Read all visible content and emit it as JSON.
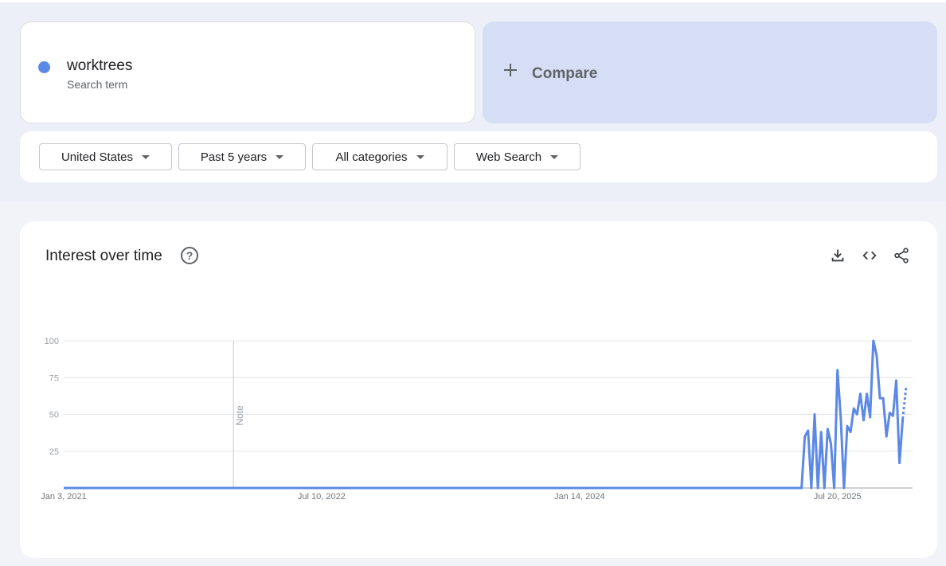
{
  "search_term": {
    "name": "worktrees",
    "subtitle": "Search term",
    "color": "#5c88e6"
  },
  "compare": {
    "label": "Compare"
  },
  "filters": [
    {
      "label": "United States"
    },
    {
      "label": "Past 5 years"
    },
    {
      "label": "All categories"
    },
    {
      "label": "Web Search"
    }
  ],
  "interest_panel": {
    "title": "Interest over time",
    "icons": [
      "help-icon",
      "download-icon",
      "embed-code-icon",
      "share-icon"
    ]
  },
  "chart_data": {
    "type": "line",
    "x_range": [
      "2021-01-03",
      "2025-12-28"
    ],
    "ylim": [
      0,
      100
    ],
    "y_ticks": [
      25,
      50,
      75,
      100
    ],
    "x_tick_labels": [
      "Jan 3, 2021",
      "Jul 10, 2022",
      "Jan 14, 2024",
      "Jul 20, 2025"
    ],
    "x_tick_dates": [
      "2021-01-03",
      "2022-07-10",
      "2024-01-14",
      "2025-07-20"
    ],
    "annotation": {
      "label": "Note",
      "date": "2022-01-02"
    },
    "grid": true,
    "series": [
      {
        "name": "worktrees",
        "color": "#5c88e6",
        "points": [
          [
            "2021-01-03",
            0
          ],
          [
            "2025-05-04",
            0
          ],
          [
            "2025-05-11",
            35
          ],
          [
            "2025-05-18",
            39
          ],
          [
            "2025-05-25",
            0
          ],
          [
            "2025-06-01",
            50
          ],
          [
            "2025-06-08",
            0
          ],
          [
            "2025-06-15",
            38
          ],
          [
            "2025-06-22",
            0
          ],
          [
            "2025-06-29",
            40
          ],
          [
            "2025-07-06",
            30
          ],
          [
            "2025-07-13",
            0
          ],
          [
            "2025-07-20",
            80
          ],
          [
            "2025-07-27",
            48
          ],
          [
            "2025-08-03",
            0
          ],
          [
            "2025-08-10",
            42
          ],
          [
            "2025-08-17",
            38
          ],
          [
            "2025-08-24",
            54
          ],
          [
            "2025-08-31",
            50
          ],
          [
            "2025-09-07",
            64
          ],
          [
            "2025-09-14",
            46
          ],
          [
            "2025-09-21",
            64
          ],
          [
            "2025-09-28",
            48
          ],
          [
            "2025-10-05",
            100
          ],
          [
            "2025-10-12",
            90
          ],
          [
            "2025-10-19",
            61
          ],
          [
            "2025-10-26",
            61
          ],
          [
            "2025-11-02",
            35
          ],
          [
            "2025-11-09",
            51
          ],
          [
            "2025-11-16",
            49
          ],
          [
            "2025-11-23",
            73
          ],
          [
            "2025-11-30",
            17
          ],
          [
            "2025-12-07",
            47
          ]
        ],
        "partial_points": [
          [
            "2025-12-07",
            47
          ],
          [
            "2025-12-14",
            68
          ]
        ]
      }
    ]
  }
}
